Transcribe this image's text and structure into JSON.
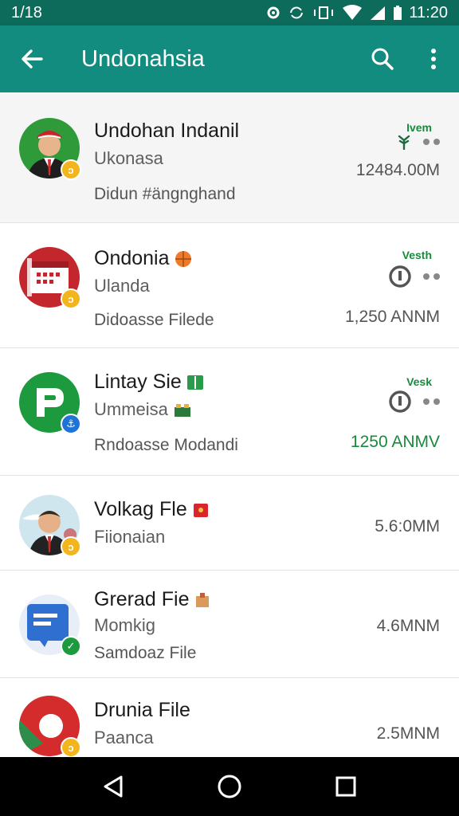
{
  "status_bar": {
    "time_left": "1/18",
    "time_right": "11:20"
  },
  "app_bar": {
    "title": "Undonahsia"
  },
  "items": [
    {
      "name": "Undohan Indanil",
      "sub": "Ukonasa",
      "meta": "Didun #ängnghand",
      "size": "12484.00M",
      "tag": "Ivem"
    },
    {
      "name": "Ondonia",
      "sub": "Ulanda",
      "meta": "Didoasse Filede",
      "size": "1,250 ANNM",
      "tag": "Vesth"
    },
    {
      "name": "Lintay Sie",
      "sub": "Ummeisa",
      "meta": "Rndoasse Modandi",
      "size": "1250 ANMV",
      "tag": "Vesk"
    },
    {
      "name": "Volkag Fle",
      "sub": "Fiionaian",
      "meta": "",
      "size": "5.6:0MM",
      "tag": ""
    },
    {
      "name": "Grerad Fie",
      "sub": "Momkig",
      "meta": "Samdoaz File",
      "size": "4.6MNM",
      "tag": ""
    },
    {
      "name": "Drunia File",
      "sub": "Paanca",
      "meta": "",
      "size": "2.5MNM",
      "tag": ""
    }
  ],
  "icons": {
    "back": "arrow-left-icon",
    "search": "search-icon",
    "more": "more-vert-icon",
    "nav_back": "triangle-back-icon",
    "nav_home": "circle-home-icon",
    "nav_recents": "square-recents-icon"
  },
  "colors": {
    "app_bar": "#128c7e",
    "status_bar": "#0d6b5c",
    "accent_green": "#188a3c",
    "badge_yellow": "#f2b51c",
    "badge_blue": "#1f73d6",
    "badge_green": "#1c9a3e"
  }
}
